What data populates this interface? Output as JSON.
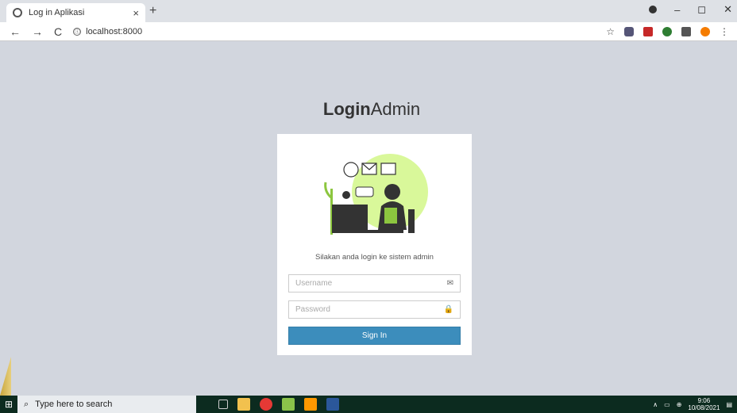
{
  "browser": {
    "tab_title": "Log in Aplikasi",
    "tab_close": "×",
    "new_tab": "+",
    "url": "localhost:8000",
    "back": "←",
    "forward": "→",
    "reload": "C",
    "info": "ⓘ"
  },
  "window": {
    "minimize": "–",
    "maximize": "◻",
    "close": "✕"
  },
  "page": {
    "logo_bold": "Login",
    "logo_light": "Admin",
    "message": "Silakan anda login ke sistem admin",
    "username_placeholder": "Username",
    "password_placeholder": "Password",
    "signin_label": "Sign In",
    "username_icon": "✉",
    "password_icon": "🔒"
  },
  "taskbar": {
    "search_placeholder": "Type here to search",
    "time": "9:06",
    "date": "10/08/2021"
  },
  "colors": {
    "button": "#3c8dbc",
    "background": "#d2d6de",
    "illustration_green": "#d9f89a"
  }
}
